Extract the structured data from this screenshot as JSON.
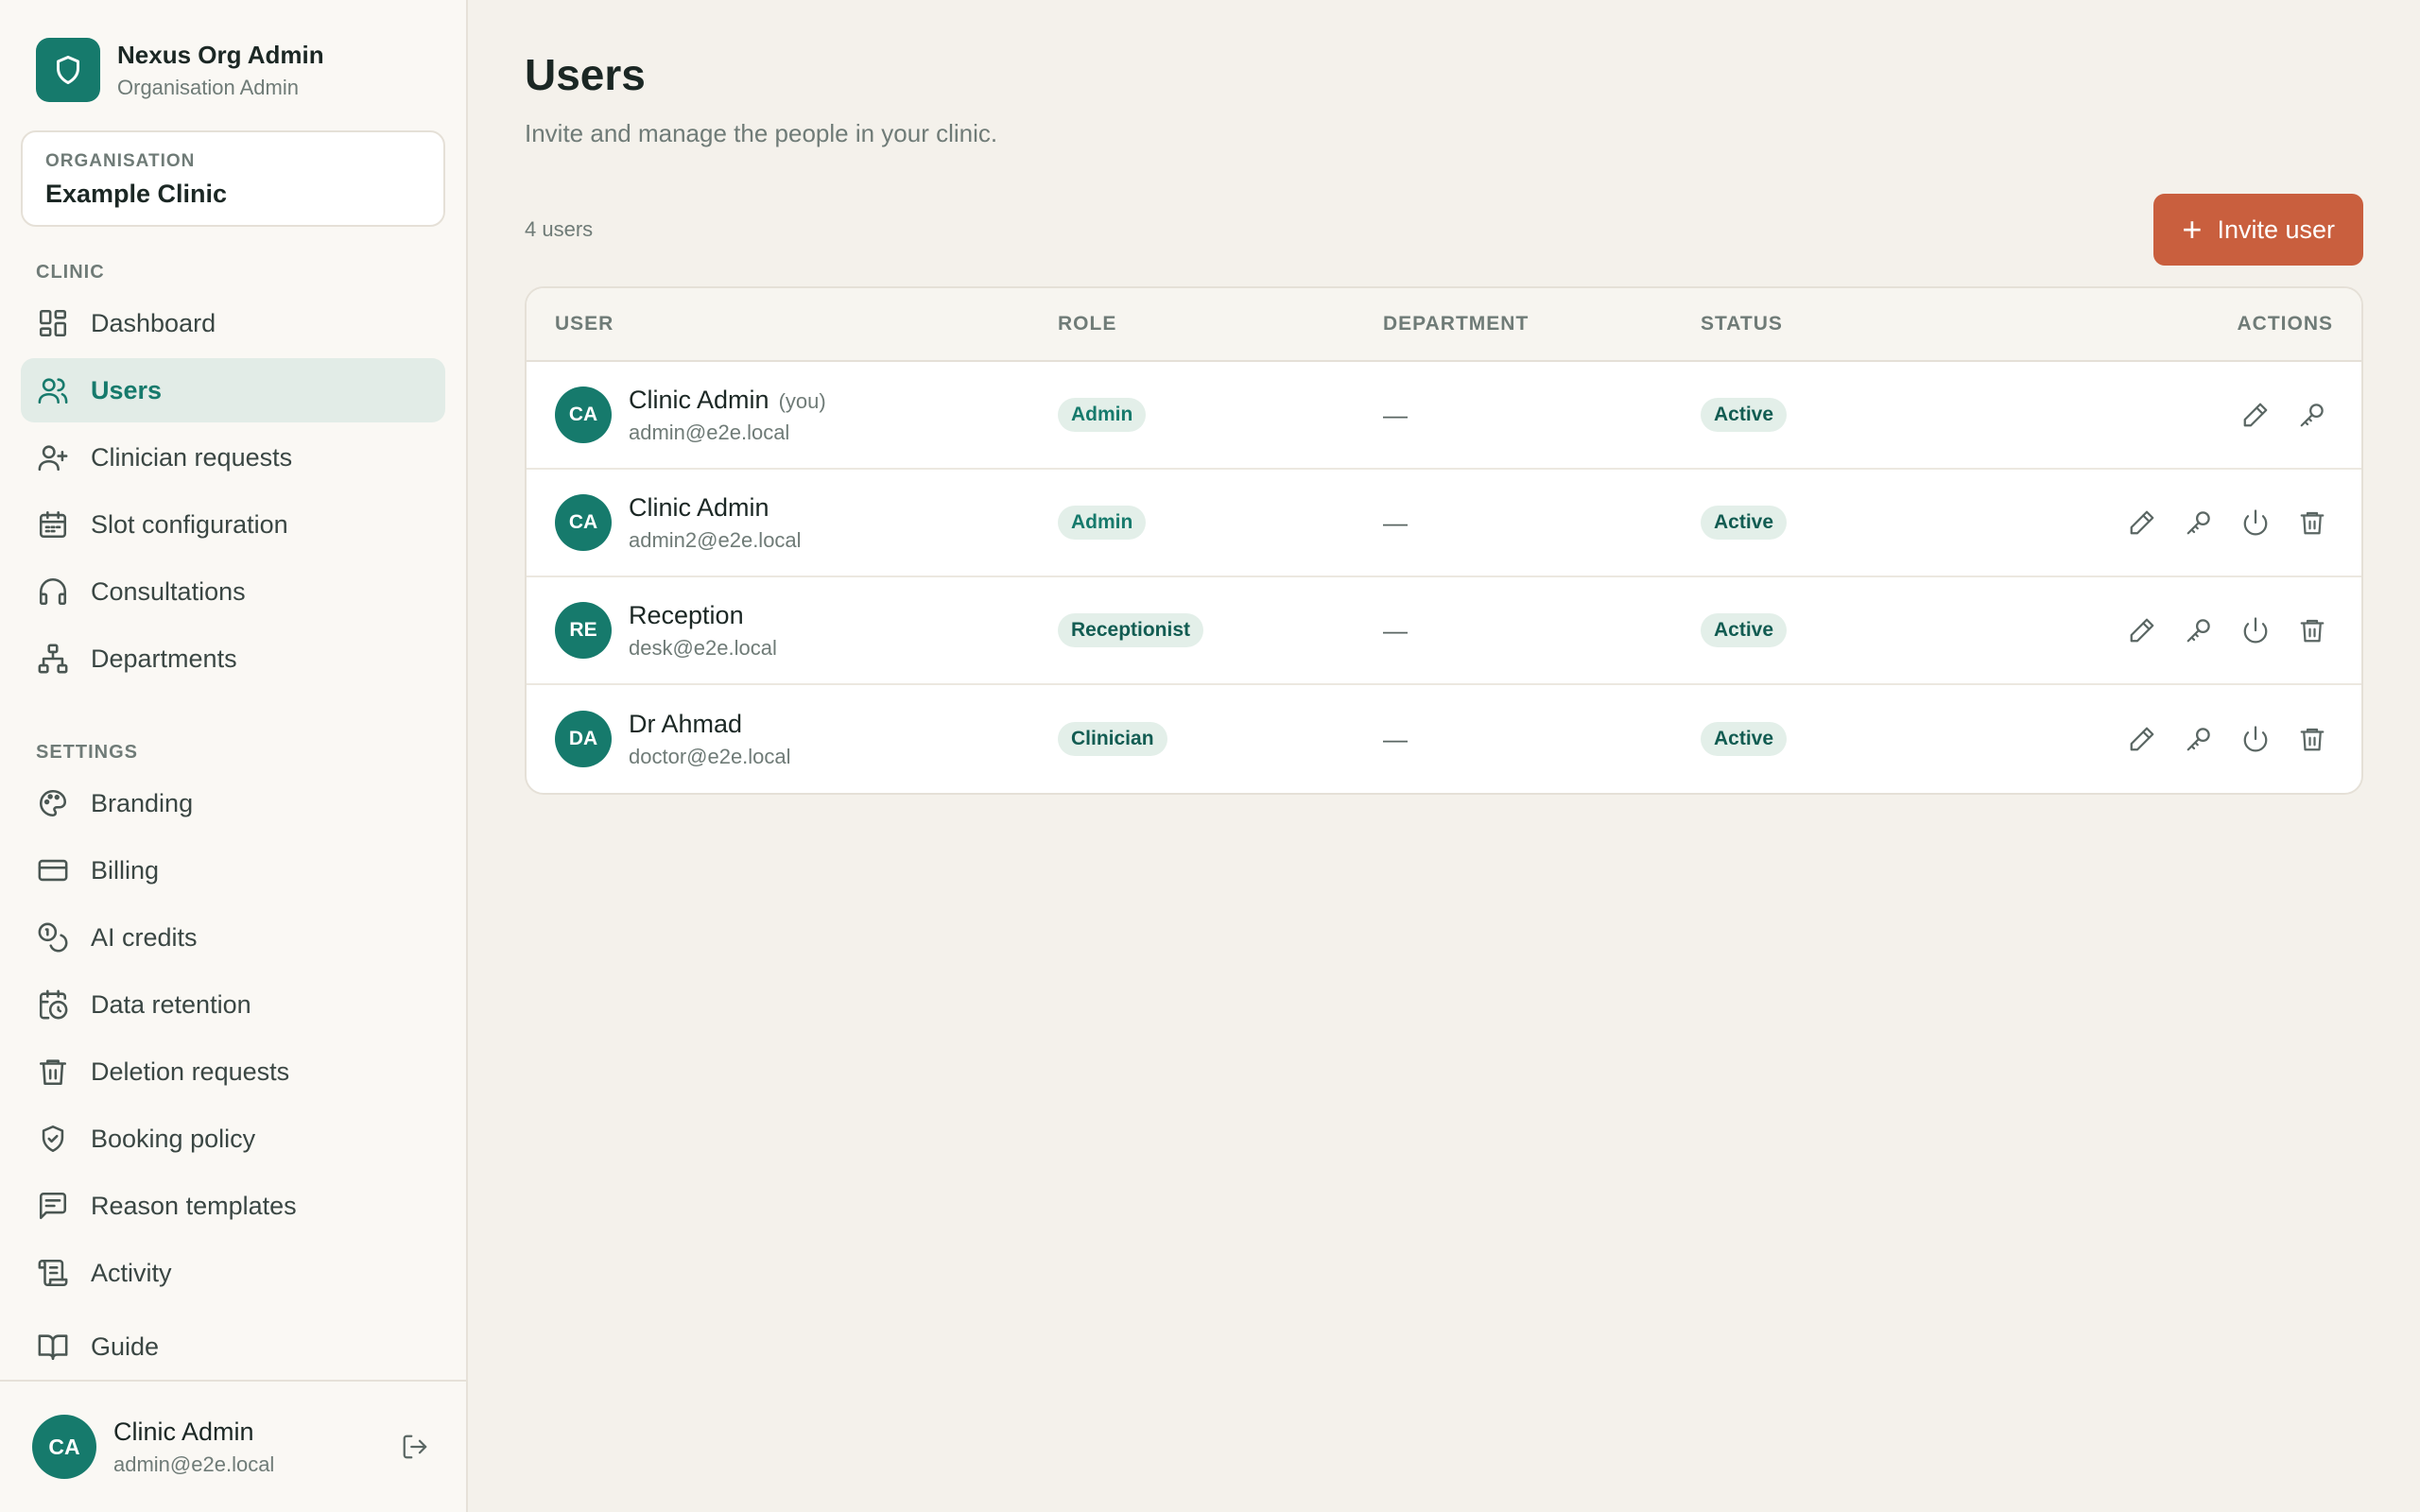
{
  "brand": {
    "title": "Nexus Org Admin",
    "subtitle": "Organisation Admin",
    "logo_icon": "shield-icon"
  },
  "organisation": {
    "label": "ORGANISATION",
    "name": "Example Clinic"
  },
  "nav": {
    "clinic_label": "CLINIC",
    "clinic_items": [
      {
        "label": "Dashboard",
        "icon": "dashboard-icon",
        "active": false
      },
      {
        "label": "Users",
        "icon": "users-icon",
        "active": true
      },
      {
        "label": "Clinician requests",
        "icon": "user-plus-icon",
        "active": false
      },
      {
        "label": "Slot configuration",
        "icon": "calendar-icon",
        "active": false
      },
      {
        "label": "Consultations",
        "icon": "headphones-icon",
        "active": false
      },
      {
        "label": "Departments",
        "icon": "org-chart-icon",
        "active": false
      }
    ],
    "settings_label": "SETTINGS",
    "settings_items": [
      {
        "label": "Branding",
        "icon": "palette-icon"
      },
      {
        "label": "Billing",
        "icon": "credit-card-icon"
      },
      {
        "label": "AI credits",
        "icon": "coins-icon"
      },
      {
        "label": "Data retention",
        "icon": "calendar-clock-icon"
      },
      {
        "label": "Deletion requests",
        "icon": "trash-icon"
      },
      {
        "label": "Booking policy",
        "icon": "shield-check-icon"
      },
      {
        "label": "Reason templates",
        "icon": "message-square-icon"
      },
      {
        "label": "Activity",
        "icon": "scroll-icon"
      }
    ],
    "guide_label": "Guide",
    "guide_icon": "book-icon"
  },
  "footer": {
    "initials": "CA",
    "name": "Clinic Admin",
    "email": "admin@e2e.local",
    "logout_icon": "logout-icon"
  },
  "page": {
    "title": "Users",
    "subtitle": "Invite and manage the people in your clinic.",
    "count": "4 users",
    "invite_label": "Invite user"
  },
  "table": {
    "headers": {
      "user": "USER",
      "role": "ROLE",
      "department": "DEPARTMENT",
      "status": "STATUS",
      "actions": "ACTIONS"
    },
    "rows": [
      {
        "initials": "CA",
        "name": "Clinic Admin",
        "you": "(you)",
        "email": "admin@e2e.local",
        "role": "Admin",
        "department": "—",
        "status": "Active",
        "actions": [
          "edit",
          "reset-password"
        ]
      },
      {
        "initials": "CA",
        "name": "Clinic Admin",
        "you": "",
        "email": "admin2@e2e.local",
        "role": "Admin",
        "department": "—",
        "status": "Active",
        "actions": [
          "edit",
          "reset-password",
          "deactivate",
          "delete"
        ]
      },
      {
        "initials": "RE",
        "name": "Reception",
        "you": "",
        "email": "desk@e2e.local",
        "role": "Receptionist",
        "department": "—",
        "status": "Active",
        "actions": [
          "edit",
          "reset-password",
          "deactivate",
          "delete"
        ]
      },
      {
        "initials": "DA",
        "name": "Dr Ahmad",
        "you": "",
        "email": "doctor@e2e.local",
        "role": "Clinician",
        "department": "—",
        "status": "Active",
        "actions": [
          "edit",
          "reset-password",
          "deactivate",
          "delete"
        ]
      }
    ]
  },
  "colors": {
    "accent": "#167a6c",
    "primary_button": "#c95f3e",
    "background": "#f4f1eb"
  }
}
